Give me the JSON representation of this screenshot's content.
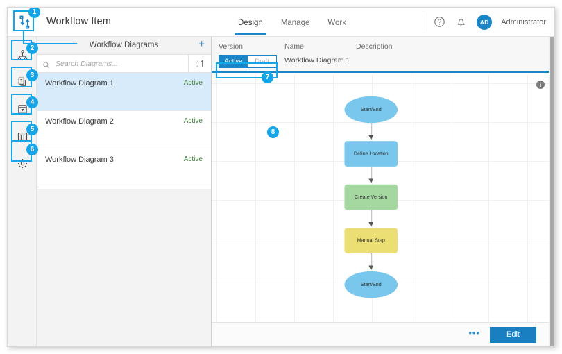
{
  "app": {
    "title": "Workflow Item",
    "logo_icon": "workflow-logo-icon"
  },
  "nav": {
    "tabs": [
      {
        "label": "Design",
        "active": true
      },
      {
        "label": "Manage",
        "active": false
      },
      {
        "label": "Work",
        "active": false
      }
    ]
  },
  "header_right": {
    "help_icon": "help-circle-icon",
    "notification_icon": "bell-icon",
    "avatar_initials": "AD",
    "user_name": "Administrator"
  },
  "rail": {
    "items": [
      {
        "icon": "hierarchy-icon",
        "name": "sidebar-item-hierarchy"
      },
      {
        "icon": "copy-icon",
        "name": "sidebar-item-copy"
      },
      {
        "icon": "notes-icon",
        "name": "sidebar-item-notes"
      },
      {
        "icon": "table-icon",
        "name": "sidebar-item-table"
      },
      {
        "icon": "gear-icon",
        "name": "sidebar-item-settings"
      }
    ]
  },
  "list_panel": {
    "title": "Workflow Diagrams",
    "add_label": "+",
    "search_placeholder": "Search Diagrams...",
    "search_value": "",
    "search_icon": "search-icon",
    "sort_icon": "sort-az-icon",
    "items": [
      {
        "name": "Workflow Diagram 1",
        "status": "Active",
        "selected": true
      },
      {
        "name": "Workflow Diagram 2",
        "status": "Active",
        "selected": false
      },
      {
        "name": "Workflow Diagram 3",
        "status": "Active",
        "selected": false
      }
    ]
  },
  "detail": {
    "col_version": "Version",
    "col_name": "Name",
    "col_description": "Description",
    "version_active": "Active",
    "version_draft": "Draft",
    "selected_version": "Active",
    "name": "Workflow Diagram 1",
    "description": "",
    "info_icon": "info-icon",
    "info_glyph": "i"
  },
  "diagram": {
    "nodes": [
      {
        "label": "Start/End",
        "shape": "ellipse",
        "color": "#79c7ec"
      },
      {
        "label": "Define Location",
        "shape": "rect",
        "color": "#79c7ec"
      },
      {
        "label": "Create Version",
        "shape": "rect",
        "color": "#a4d8a0"
      },
      {
        "label": "Manual Step",
        "shape": "rect",
        "color": "#ebdf73"
      },
      {
        "label": "Start/End",
        "shape": "ellipse",
        "color": "#79c7ec"
      }
    ]
  },
  "footer": {
    "more_label": "•••",
    "edit_label": "Edit"
  },
  "callouts": [
    {
      "n": "1"
    },
    {
      "n": "2"
    },
    {
      "n": "3"
    },
    {
      "n": "4"
    },
    {
      "n": "5"
    },
    {
      "n": "6"
    },
    {
      "n": "7"
    },
    {
      "n": "8"
    }
  ],
  "colors": {
    "accent": "#1a86c8",
    "callout": "#16a6e8",
    "status_active": "#45823f",
    "selected_row": "#d8ebfb"
  }
}
